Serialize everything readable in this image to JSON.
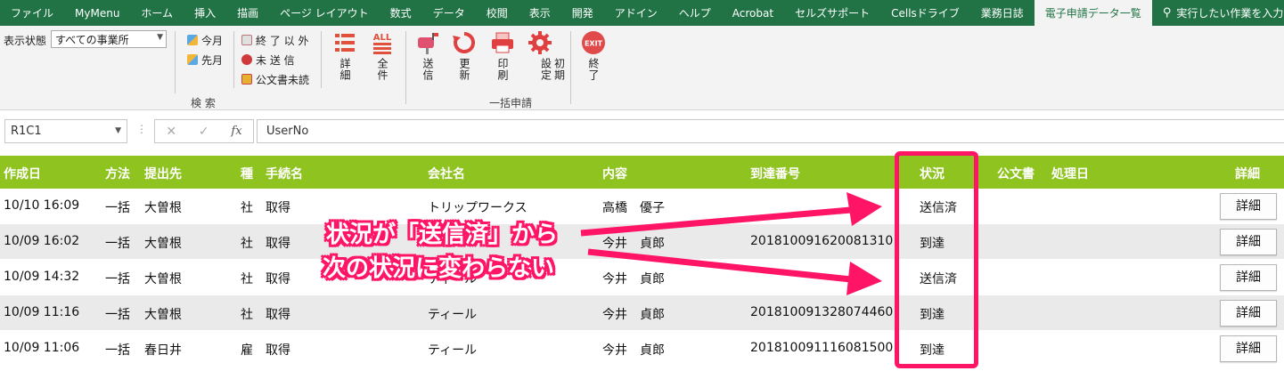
{
  "ribbon_tabs": [
    "ファイル",
    "MyMenu",
    "ホーム",
    "挿入",
    "描画",
    "ページ レイアウト",
    "数式",
    "データ",
    "校閲",
    "表示",
    "開発",
    "アドイン",
    "ヘルプ",
    "Acrobat",
    "セルズサポート",
    "Cellsドライブ",
    "業務日誌",
    "電子申請データ一覧"
  ],
  "active_tab_index": 17,
  "tell_me": "実行したい作業を入力してください",
  "ribbon": {
    "display_state_label": "表示状態",
    "display_state_value": "すべての事業所",
    "search_group": {
      "label": "検 索",
      "this_month": "今月",
      "last_month": "先月",
      "not_finished": "終 了 以 外",
      "unsent": "未 送 信",
      "doc_unread": "公文書未読",
      "detail": "詳細",
      "all": "全件"
    },
    "batch_group": {
      "label": "一括申請",
      "send": "送信",
      "refresh": "更新",
      "print": "印刷",
      "settings_line1": "初期",
      "settings_line2": "設定"
    },
    "exit": "終了",
    "exit_icon_text": "EXIT",
    "all_icon_text": "ALL"
  },
  "formula_bar": {
    "name_box": "R1C1",
    "formula": "UserNo"
  },
  "table": {
    "headers": {
      "created": "作成日",
      "method": "方法",
      "submit_to": "提出先",
      "kind": "種",
      "procedure": "手続名",
      "company": "会社名",
      "content": "内容",
      "arrival_no": "到達番号",
      "status": "状況",
      "official_doc": "公文書",
      "processed": "処理日",
      "detail": "詳細"
    },
    "rows": [
      {
        "created": "10/10 16:09",
        "method": "一括",
        "submit_to": "大曽根",
        "kind": "社",
        "procedure": "取得",
        "company": "トリップワークス",
        "content": "高橋　優子",
        "arrival_no": "",
        "status": "送信済",
        "detail": "詳細"
      },
      {
        "created": "10/09 16:02",
        "method": "一括",
        "submit_to": "大曽根",
        "kind": "社",
        "procedure": "取得",
        "company": "",
        "content": "今井　貞郎",
        "arrival_no": "201810091620081310",
        "status": "到達",
        "detail": "詳細"
      },
      {
        "created": "10/09 14:32",
        "method": "一括",
        "submit_to": "大曽根",
        "kind": "社",
        "procedure": "取得",
        "company": "ティール",
        "content": "今井　貞郎",
        "arrival_no": "",
        "status": "送信済",
        "detail": "詳細"
      },
      {
        "created": "10/09 11:16",
        "method": "一括",
        "submit_to": "大曽根",
        "kind": "社",
        "procedure": "取得",
        "company": "ティール",
        "content": "今井　貞郎",
        "arrival_no": "201810091328074460",
        "status": "到達",
        "detail": "詳細"
      },
      {
        "created": "10/09 11:06",
        "method": "一括",
        "submit_to": "春日井",
        "kind": "雇",
        "procedure": "取得",
        "company": "ティール",
        "content": "今井　貞郎",
        "arrival_no": "201810091116081500",
        "status": "到達",
        "detail": "詳細"
      }
    ]
  },
  "annotation": {
    "line1": "状況が「送信済」から",
    "line2": "次の状況に変わらない",
    "color": "#ff1466"
  },
  "colors": {
    "ribbon_green": "#217346",
    "header_green": "#8fc31f",
    "highlight_pink": "#ff1466"
  }
}
